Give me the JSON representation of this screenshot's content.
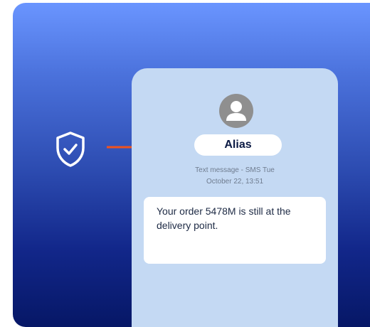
{
  "icons": {
    "shield": "shield-check-icon",
    "arrow": "arrow-right-icon",
    "avatar": "user-avatar-icon"
  },
  "colors": {
    "arrow": "#f0531e",
    "gradient_top": "#6a95ff",
    "gradient_bottom": "#061766",
    "phone_bg": "#c4d9f3"
  },
  "message": {
    "sender": "Alias",
    "meta_line1": "Text message - SMS Tue",
    "meta_line2": "October 22, 13:51",
    "text": "Your order 5478M is still at the delivery point."
  }
}
